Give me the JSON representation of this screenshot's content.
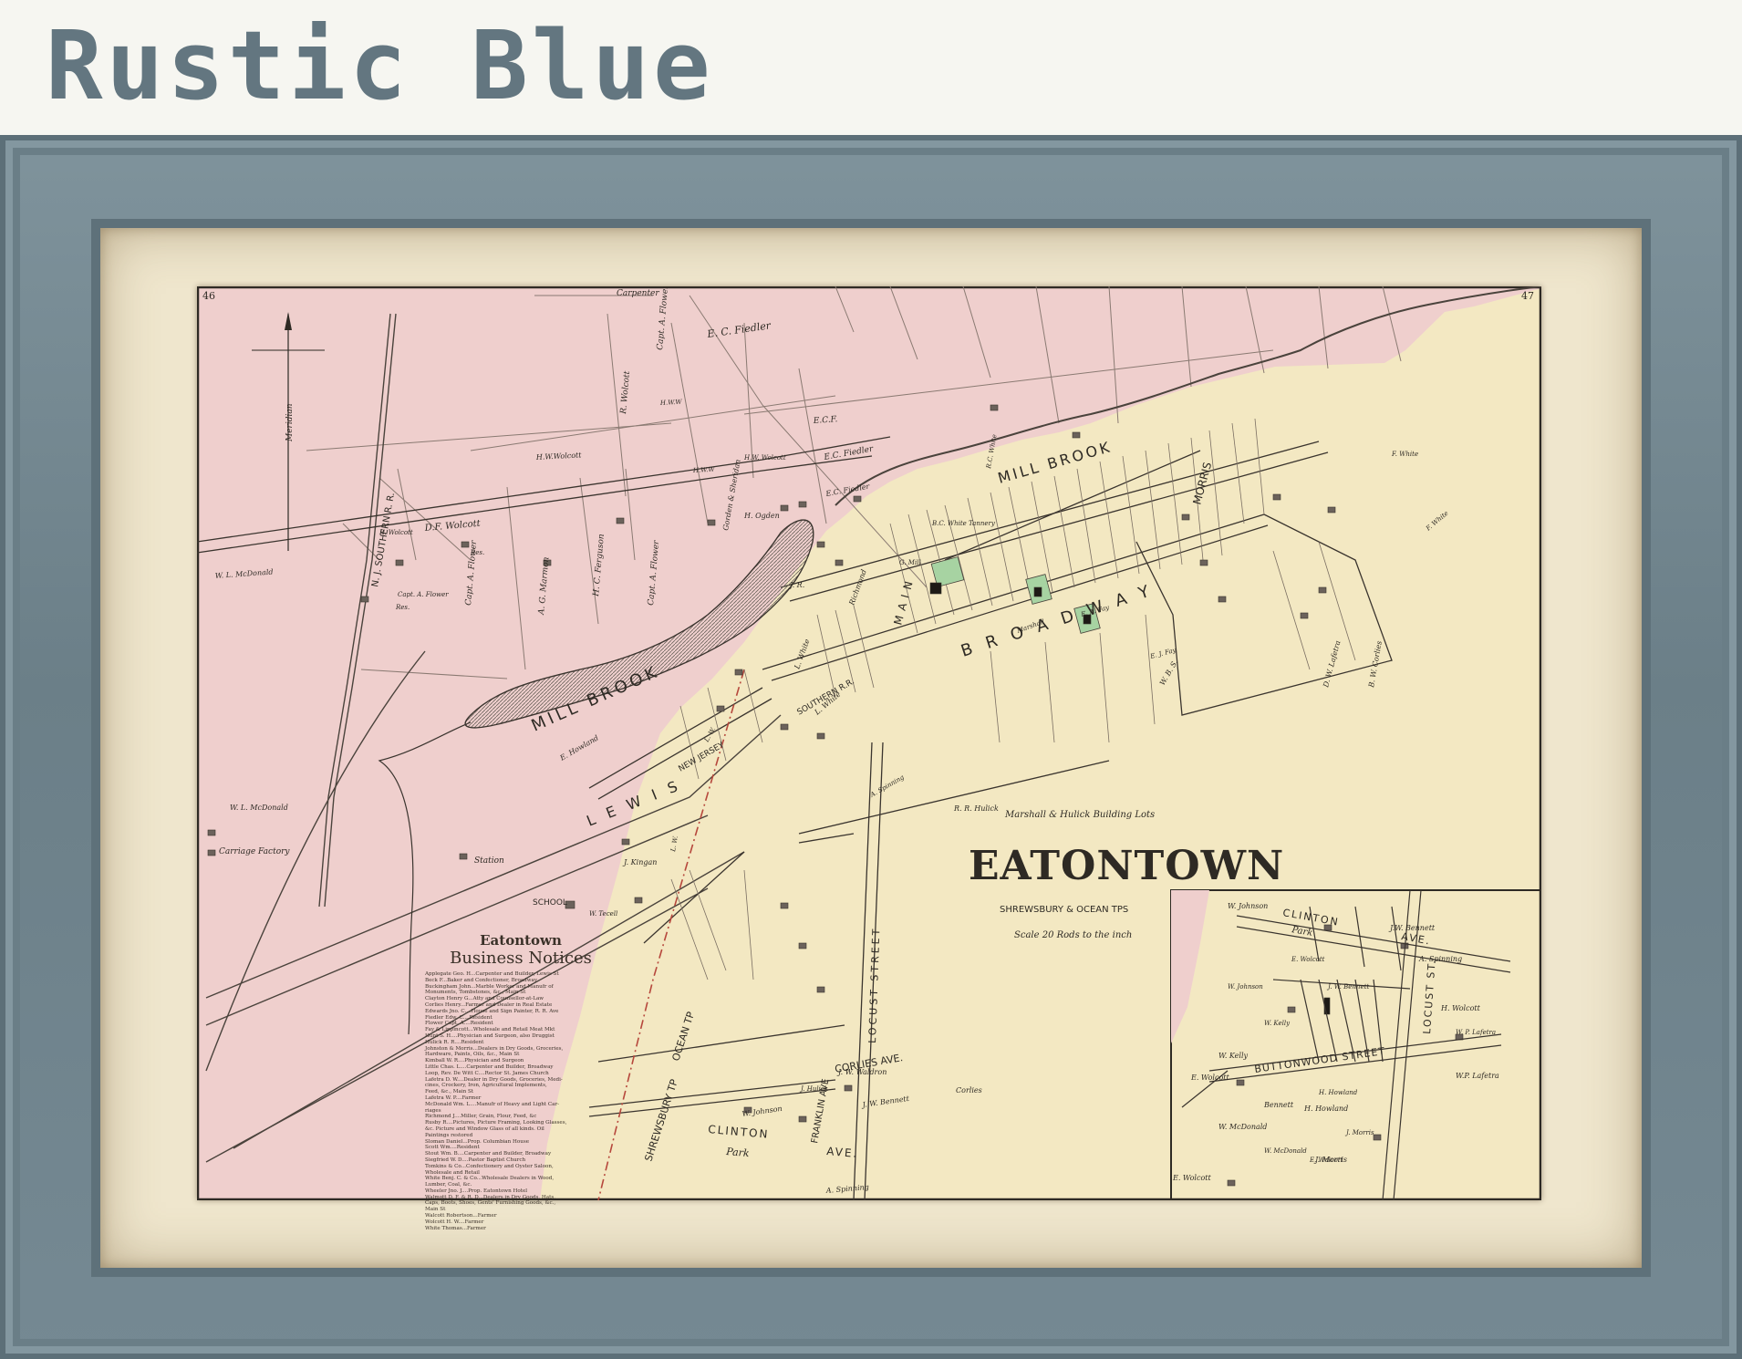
{
  "header": {
    "title": "Rustic Blue"
  },
  "map": {
    "page_numbers": {
      "left": "46",
      "right": "47"
    },
    "title": "EATONTOWN",
    "subtitle": "SHREWSBURY & OCEAN TPS",
    "scale": "Scale 20 Rods to the inch",
    "colors": {
      "pink_township": "#efcfcd",
      "yellow_township": "#f3e8c2",
      "green_lot": "#a7d3a2",
      "frame": "#6e828b",
      "mat": "#efe6cd"
    },
    "labels": {
      "meridian": "Meridian",
      "railroad": "N. J. SOUTHERN R. R.",
      "southern_rr": "SOUTHERN R.R.",
      "new_jersey": "NEW JERSEY",
      "mill_brook_upper": "MILL BROOK",
      "mill_brook_pond": "MILL BROOK",
      "broadway": "BROADWAY",
      "lewis": "LEWIS",
      "morris": "MORRIS",
      "main": "MAIN",
      "shrewsbury_tp": "SHREWSBURY TP",
      "ocean_tp": "OCEAN TP",
      "locust_street": "LOCUST STREET",
      "franklin_ave": "FRANKLIN AVE",
      "corlies_ave": "CORLIES AVE.",
      "clinton": "CLINTON",
      "ave": "AVE.",
      "park": "Park",
      "school": "SCHOOL",
      "station": "Station",
      "carriage_factory": "Carriage Factory",
      "building_lots": "Marshall & Hulick Building Lots"
    },
    "owners": [
      "Carpenter",
      "Capt. A. Flower",
      "E. C. Fiedler",
      "R. Wolcott",
      "H.W.W",
      "H.W.Wolcott",
      "H.W.W",
      "H.W. Wolcott",
      "E.C.F.",
      "E.C. Fiedler",
      "E.C. Fiedler",
      "D.F. Wolcott",
      "Res.",
      "R. Wolcott",
      "W. L. McDonald",
      "Capt. A. Flower",
      "Res.",
      "Capt. A. Flower",
      "A. G. Marmon",
      "H. C. Ferguson",
      "Capt. A. Flower",
      "Gorden & Sheridan",
      "H. Ogden",
      "J. R.",
      "G. Mill",
      "Richmond",
      "B.C. White Tannery",
      "R.C. White",
      "F. White",
      "F. White",
      "L. White",
      "L. White",
      "E. Howland",
      "W. L. McDonald",
      "J. Kingan",
      "W. Tecell",
      "L. W.",
      "L. W.",
      "Marshall",
      "E. J. Fay",
      "E. A. Fay",
      "W. B. S.",
      "D. W. Lafetra",
      "B. W. Corlies",
      "R. R. Hulick",
      "J. W. Waldron",
      "Corlies",
      "J. Hulick",
      "W. Johnson",
      "J. W. Bennett",
      "A. Spinning",
      "A. Spinning",
      "E. Wolcott",
      "W. Kelly",
      "W. P. Lafetra",
      "H. Howland",
      "J. Morris",
      "W. McDonald",
      "E. Wolcott",
      "J. W. Bennett",
      "W. Johnson"
    ],
    "inset": {
      "clinton": "CLINTON",
      "ave": "AVE.",
      "park": "Park",
      "buttonwood": "BUTTONWOOD STREET",
      "locust": "LOCUST ST.",
      "w_johnson": "W. Johnson",
      "jw_bennett": "J.W. Bennett",
      "a_spinning": "A. Spinning",
      "w_kelly": "W. Kelly",
      "e_wolcott": "E. Wolcott",
      "w_mcdonald": "W. McDonald",
      "e_wolcott2": "E. Wolcott",
      "h_howland": "H. Howland",
      "j_morris": "J. Morris",
      "wp_lafetra": "W.P. Lafetra",
      "h_wolcott": "H. Wolcott",
      "bennett": "Bennett"
    },
    "business_notices": {
      "heading_1": "Eatontown",
      "heading_2": "Business Notices",
      "entries": [
        "Applegate Geo. H...Carpenter and Builder, Lewis St",
        "Beck F...Baker and Confectioner, Broadway",
        "Buckingham John...Marble Worker and Manufr of",
        "      Monuments, Tombstones, &c., Main St",
        "Clayton Henry G...Atty and Counsellor-at-Law",
        "Corlies Henry...Farmer and Dealer in Real Estate",
        "Edwards Jno. C....House and Sign Painter, R. R. Ave",
        "Fiedler Edw. C....Resident",
        "Flower Capt. A....Resident",
        "Fay & Lippincott...Wholesale and Retail Meat Mkt",
        "Hunt S. H....Physician and Surgeon, also Druggist",
        "Hulick R. R....Resident",
        "Johnston & Morris...Dealers in Dry Goods, Groceries,",
        "      Hardware, Paints, Oils, &c., Main St",
        "Kimball W. R....Physician and Surgeon",
        "Little Chas. L....Carpenter and Builder, Broadway",
        "Loop, Rev. De Witt C....Rector St. James Church",
        "Lafetra D. W....Dealer in Dry Goods, Groceries, Medi-",
        "      cines, Crockery, Iron, Agricultural Implements,",
        "      Feed, &c., Main St",
        "Lafetra W. P....Farmer",
        "McDonald Wm. L....Manufr of Heavy and Light Car-",
        "      riages",
        "Richmond J....Miller, Grain, Flour, Feed, &c",
        "Rusby R....Pictures, Picture Framing, Looking Glasses,",
        "      &c.   Picture and Window Glass of all kinds.  Oil",
        "      Paintings restored",
        "Sloman Daniel...Prop. Columbian House",
        "Scott Wm....Resident",
        "Stout Wm. B....Carpenter and Builder, Broadway",
        "Siegfried W. D....Pastor Baptist Church",
        "Tomkins & Co...Confectionery and Oyster Saloon,",
        "      Wholesale and Retail",
        "White Benj. C. & Co...Wholesale Dealers in Wood,",
        "      Lumber, Coal, &c.",
        "Wheeler Jno. J....Prop. Eatontown Hotel",
        "Walmott D. F. & R. D...Dealers in Dry Goods, Hats,",
        "      Caps, Boots, Shoes, Gents' Furnishing Goods, &c.,",
        "      Main St",
        "Walcott Robertson...Farmer",
        "Wolcott H. W....Farmer",
        "White Thomas...Farmer"
      ]
    }
  }
}
